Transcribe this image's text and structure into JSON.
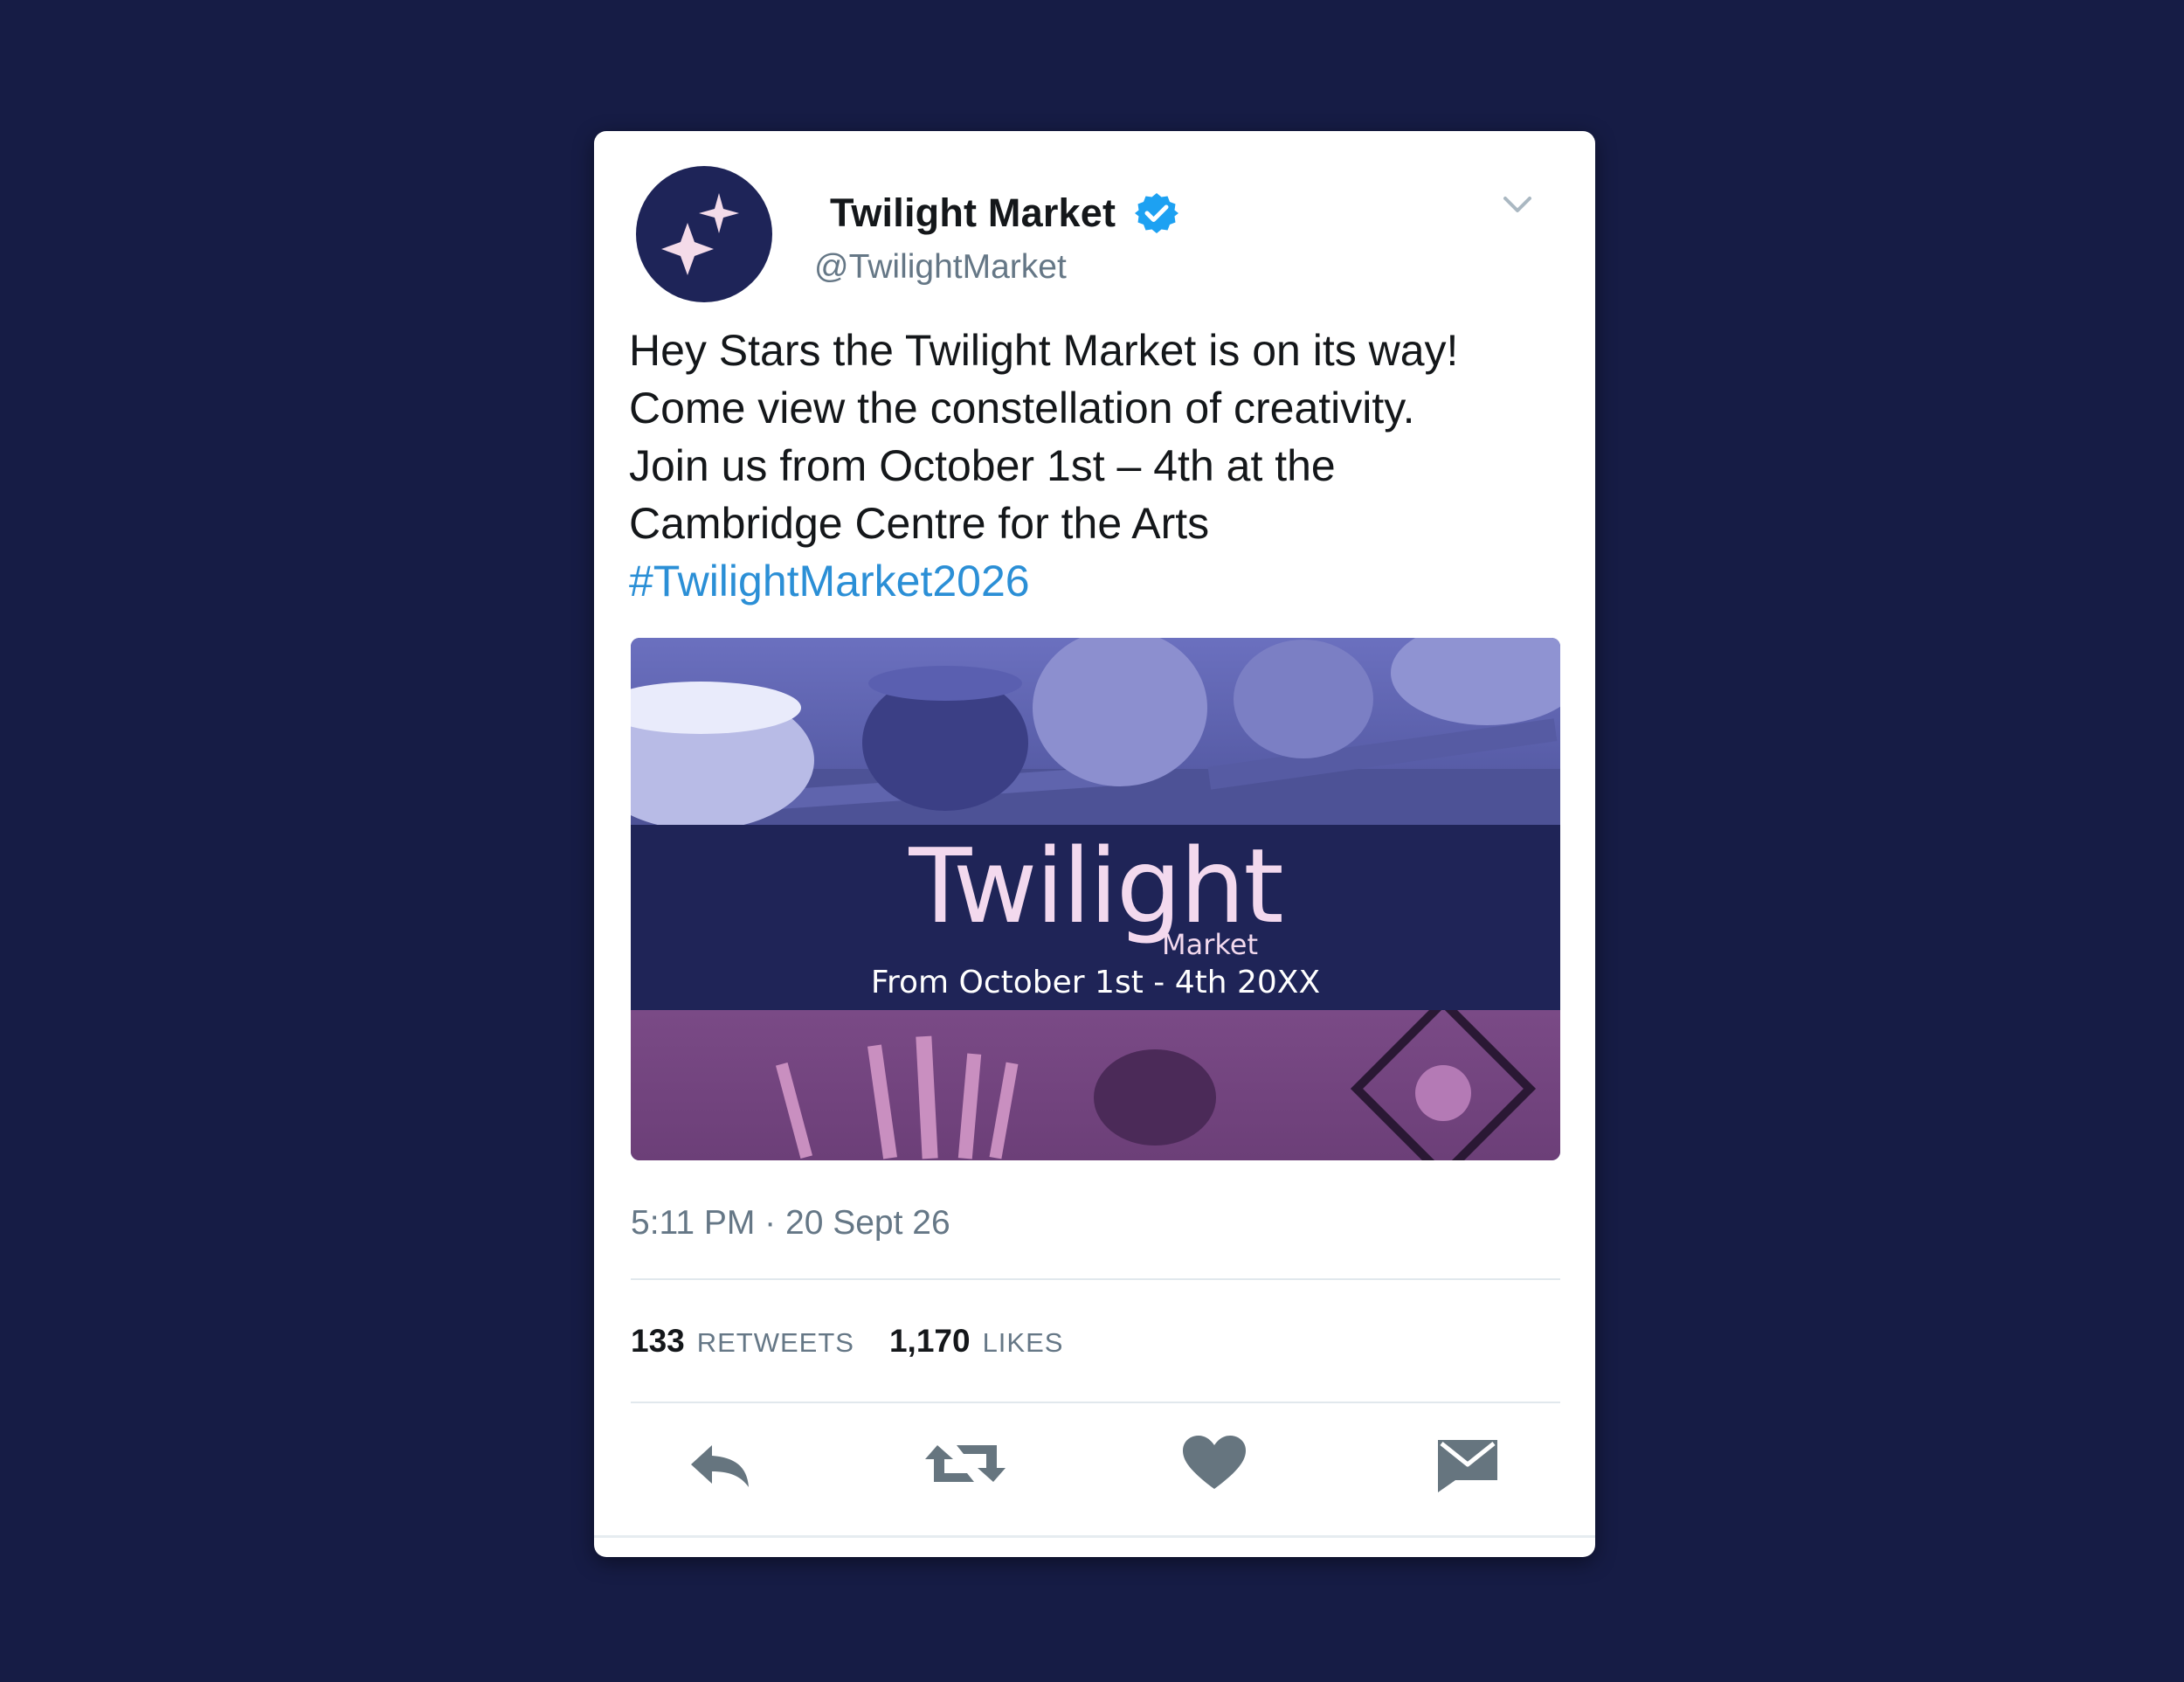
{
  "tweet": {
    "display_name": "Twilight Market",
    "handle": "@TwilightMarket",
    "verified": true,
    "text_lines": [
      "Hey Stars the Twilight Market is on its way!",
      "Come view the constellation of creativity.",
      "Join us from October 1st – 4th at the",
      "Cambridge Centre for the Arts"
    ],
    "hashtag": "#TwilightMarket2026",
    "timestamp": "5:11 PM · 20 Sept 26",
    "retweet_count": "133",
    "retweet_label": "RETWEETS",
    "like_count": "1,170",
    "like_label": "LIKES"
  },
  "media": {
    "logo_word": "Twilight",
    "logo_sub": "Market",
    "date_text": "From October 1st - 4th 20XX"
  },
  "icons": {
    "avatar": "sparkle-stars-icon",
    "verified": "verified-badge-icon",
    "menu": "chevron-down-icon",
    "reply": "reply-icon",
    "retweet": "retweet-icon",
    "like": "heart-icon",
    "dm": "envelope-icon"
  },
  "colors": {
    "background": "#161c45",
    "card": "#ffffff",
    "avatar": "#1e2458",
    "verified": "#1da1f2",
    "hashtag": "#2b8fd6",
    "muted_text": "#657786",
    "action_icons": "#66757f",
    "media_band": "#1f2457"
  }
}
